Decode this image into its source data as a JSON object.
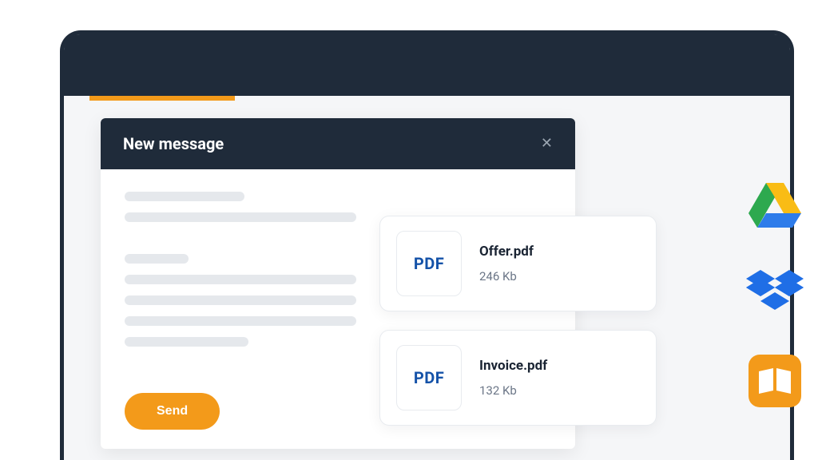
{
  "compose": {
    "title": "New message",
    "send_label": "Send",
    "pdf_label": "PDF"
  },
  "attachments": [
    {
      "name": "Offer.pdf",
      "size": "246 Kb"
    },
    {
      "name": "Invoice.pdf",
      "size": "132 Kb"
    }
  ],
  "services": {
    "drive": "google-drive",
    "dropbox": "dropbox",
    "flipsnack": "flipsnack"
  },
  "colors": {
    "accent": "#f39a1a",
    "dark": "#1f2b3a",
    "pdf": "#1452a8"
  }
}
